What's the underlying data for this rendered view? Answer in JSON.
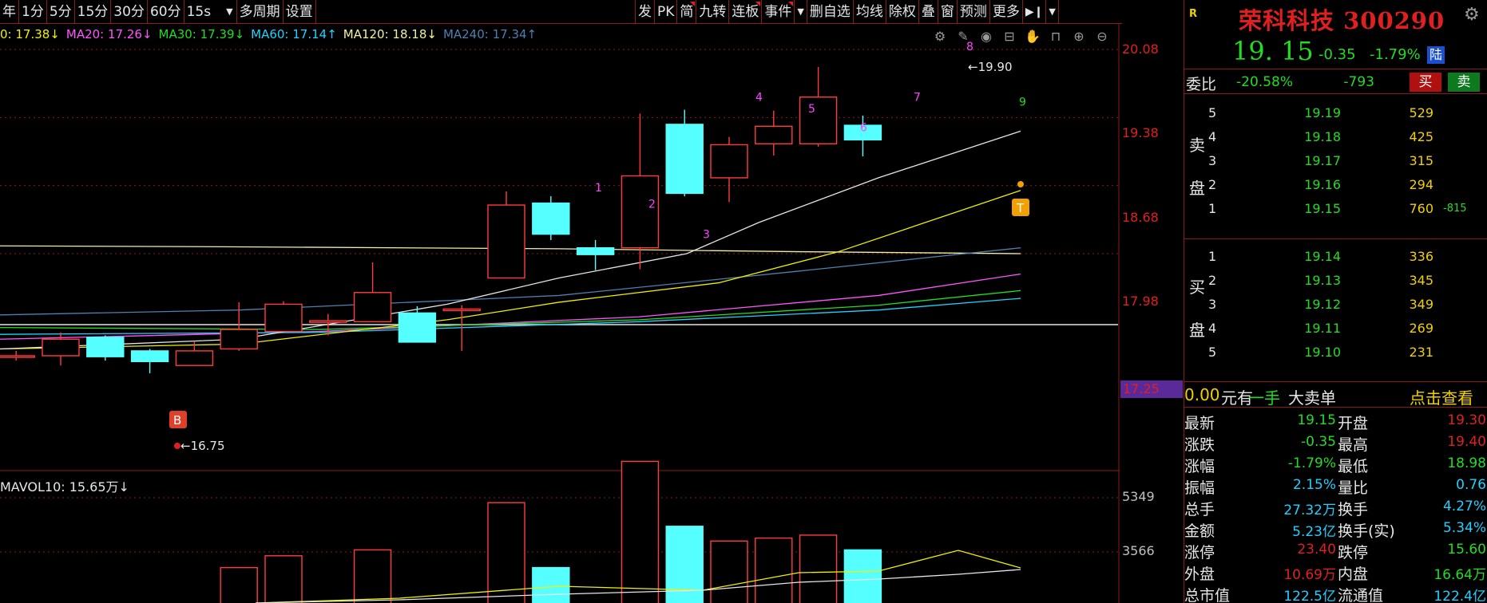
{
  "toolbar": {
    "left": [
      "年",
      "1分",
      "5分",
      "15分",
      "30分",
      "60分"
    ],
    "interval": "15s",
    "left2": [
      "多周期",
      "设置"
    ],
    "right": [
      "发",
      "PK",
      "简",
      "九转",
      "连板",
      "事件",
      "删自选",
      "均线",
      "除权",
      "叠",
      "窗",
      "预测",
      "更多"
    ]
  },
  "ma_legend": [
    {
      "text": "0: 17.38↓",
      "color": "#f0f000"
    },
    {
      "text": "MA20: 17.26↓",
      "color": "#ff55ff"
    },
    {
      "text": "MA30: 17.39↓",
      "color": "#22dd22"
    },
    {
      "text": "MA60: 17.14↑",
      "color": "#22d0ff"
    },
    {
      "text": "MA120: 18.18↓",
      "color": "#f0f0a0"
    },
    {
      "text": "MA240: 17.34↑",
      "color": "#4f7fb0"
    }
  ],
  "price_axis": [
    "20.08",
    "19.38",
    "18.68",
    "17.98"
  ],
  "last_line_price": "17.25",
  "vol_axis": [
    "5349",
    "3566"
  ],
  "vol_legend": "MAVOL10: 15.65万↓",
  "chart_annotations": {
    "high_label": "←19.90",
    "low_label": "←16.75",
    "buy_marker": "B",
    "t_marker": "T",
    "td_counts": [
      "1",
      "2",
      "3",
      "4",
      "5",
      "6",
      "7",
      "8",
      "9"
    ]
  },
  "stock": {
    "badge": "R",
    "name": "荣科科技 300290",
    "price": "19. 15",
    "change": "-0.35",
    "change_pct": "-1.79%",
    "tag": "陆"
  },
  "weibi": {
    "label": "委比",
    "pct": "-20.58%",
    "diff": "-793",
    "buy": "买",
    "sell": "卖"
  },
  "asks_label": [
    "卖",
    "盘"
  ],
  "bids_label": [
    "买",
    "盘"
  ],
  "asks": [
    {
      "lvl": "5",
      "px": "19.19",
      "qty": "529",
      "chg": ""
    },
    {
      "lvl": "4",
      "px": "19.18",
      "qty": "425",
      "chg": ""
    },
    {
      "lvl": "3",
      "px": "19.17",
      "qty": "315",
      "chg": ""
    },
    {
      "lvl": "2",
      "px": "19.16",
      "qty": "294",
      "chg": ""
    },
    {
      "lvl": "1",
      "px": "19.15",
      "qty": "760",
      "chg": "-815"
    }
  ],
  "bids": [
    {
      "lvl": "1",
      "px": "19.14",
      "qty": "336"
    },
    {
      "lvl": "2",
      "px": "19.13",
      "qty": "345"
    },
    {
      "lvl": "3",
      "px": "19.12",
      "qty": "349"
    },
    {
      "lvl": "4",
      "px": "19.11",
      "qty": "269"
    },
    {
      "lvl": "5",
      "px": "19.10",
      "qty": "231"
    }
  ],
  "bigorder": {
    "value": "0.00",
    "t1": "元有",
    "t2": "一手",
    "t3": "大卖单",
    "link": "点击查看"
  },
  "quote": [
    {
      "k1": "最新",
      "v1": "19.15",
      "c1": "#22dd22",
      "k2": "开盘",
      "v2": "19.30",
      "c2": "#e02020"
    },
    {
      "k1": "涨跌",
      "v1": "-0.35",
      "c1": "#22dd22",
      "k2": "最高",
      "v2": "19.40",
      "c2": "#e02020"
    },
    {
      "k1": "涨幅",
      "v1": "-1.79%",
      "c1": "#22dd22",
      "k2": "最低",
      "v2": "18.98",
      "c2": "#22dd22"
    },
    {
      "k1": "振幅",
      "v1": "2.15%",
      "c1": "#22d0ff",
      "k2": "量比",
      "v2": "0.76",
      "c2": "#22d0ff"
    },
    {
      "k1": "总手",
      "v1": "27.32万",
      "c1": "#22d0ff",
      "k2": "换手",
      "v2": "4.27%",
      "c2": "#22d0ff"
    },
    {
      "k1": "金额",
      "v1": "5.23亿",
      "c1": "#22d0ff",
      "k2": "换手(实)",
      "v2": "5.34%",
      "c2": "#22d0ff"
    },
    {
      "k1": "涨停",
      "v1": "23.40",
      "c1": "#e02020",
      "k2": "跌停",
      "v2": "15.60",
      "c2": "#22dd22"
    },
    {
      "k1": "外盘",
      "v1": "10.69万",
      "c1": "#e02020",
      "k2": "内盘",
      "v2": "16.64万",
      "c2": "#22dd22"
    },
    {
      "k1": "总市值",
      "v1": "122.5亿",
      "c1": "#22d0ff",
      "k2": "流通值",
      "v2": "122.4亿",
      "c2": "#22d0ff"
    }
  ],
  "chart_data": {
    "type": "candlestick",
    "y_axis_ticks": [
      20.08,
      19.38,
      18.68,
      17.98,
      17.25
    ],
    "candles": [
      {
        "o": 16.93,
        "c": 16.93,
        "h": 16.98,
        "l": 16.88,
        "up": true
      },
      {
        "o": 16.93,
        "c": 17.1,
        "h": 17.17,
        "l": 16.83,
        "up": true
      },
      {
        "o": 17.12,
        "c": 16.92,
        "h": 17.14,
        "l": 16.88,
        "up": false
      },
      {
        "o": 16.87,
        "c": 16.98,
        "h": 17.0,
        "l": 16.75,
        "up": false
      },
      {
        "o": 16.98,
        "c": 16.83,
        "h": 17.08,
        "l": 16.83,
        "up": true
      },
      {
        "o": 17.0,
        "c": 17.2,
        "h": 17.48,
        "l": 16.98,
        "up": true
      },
      {
        "o": 17.18,
        "c": 17.46,
        "h": 17.49,
        "l": 17.18,
        "up": true
      },
      {
        "o": 17.29,
        "c": 17.29,
        "h": 17.36,
        "l": 17.14,
        "up": true
      },
      {
        "o": 17.28,
        "c": 17.58,
        "h": 17.89,
        "l": 17.28,
        "up": true
      },
      {
        "o": 17.37,
        "c": 17.07,
        "h": 17.44,
        "l": 17.07,
        "up": false
      },
      {
        "o": 17.41,
        "c": 17.4,
        "h": 17.45,
        "l": 16.98,
        "up": true
      },
      {
        "o": 17.73,
        "c": 18.48,
        "h": 18.62,
        "l": 17.73,
        "up": true
      },
      {
        "o": 18.5,
        "c": 18.18,
        "h": 18.57,
        "l": 18.12,
        "up": false
      },
      {
        "o": 18.04,
        "c": 17.97,
        "h": 18.12,
        "l": 17.81,
        "up": false
      },
      {
        "o": 18.04,
        "c": 18.78,
        "h": 19.42,
        "l": 17.82,
        "up": true
      },
      {
        "o": 19.31,
        "c": 18.6,
        "h": 19.46,
        "l": 18.57,
        "up": false
      },
      {
        "o": 18.76,
        "c": 19.1,
        "h": 19.18,
        "l": 18.51,
        "up": true
      },
      {
        "o": 19.11,
        "c": 19.29,
        "h": 19.45,
        "l": 18.99,
        "up": true
      },
      {
        "o": 19.11,
        "c": 19.59,
        "h": 19.9,
        "l": 19.08,
        "up": true
      },
      {
        "o": 19.3,
        "c": 19.15,
        "h": 19.4,
        "l": 18.98,
        "up": false
      }
    ],
    "volume_axis_ticks": [
      5349,
      3566
    ]
  }
}
